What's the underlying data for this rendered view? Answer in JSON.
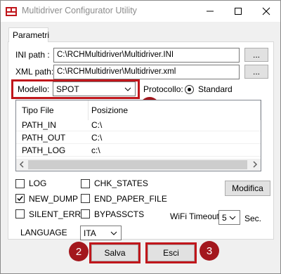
{
  "window": {
    "title": "Multidriver Configurator Utility"
  },
  "tabs": [
    {
      "label": "Parametri"
    }
  ],
  "ini": {
    "label": "INI path :",
    "value": "C:\\RCHMultidriver\\Multidriver.INI",
    "browse_label": "..."
  },
  "xml": {
    "label": "XML path:",
    "value": "C:\\RCHMultidriver\\Multidriver.xml",
    "browse_label": "..."
  },
  "modello": {
    "label": "Modello:",
    "value": "SPOT"
  },
  "protocollo": {
    "label": "Protocollo:",
    "option": "Standard",
    "selected": true
  },
  "table": {
    "columns": [
      "Tipo File",
      "Posizione"
    ],
    "rows": [
      {
        "tipo": "PATH_IN",
        "pos": "C:\\"
      },
      {
        "tipo": "PATH_OUT",
        "pos": "C:\\"
      },
      {
        "tipo": "PATH_LOG",
        "pos": "c:\\"
      }
    ]
  },
  "options": {
    "log": {
      "label": "LOG",
      "checked": false
    },
    "new_dump": {
      "label": "NEW_DUMP",
      "checked": true
    },
    "silent_err": {
      "label": "SILENT_ERR",
      "checked": false
    },
    "chk_states": {
      "label": "CHK_STATES",
      "checked": false
    },
    "end_paper_file": {
      "label": "END_PAPER_FILE",
      "checked": false
    },
    "bypassctS": {
      "label": "BYPASSCTS",
      "checked": false
    }
  },
  "modifica_label": "Modifica",
  "wifi": {
    "label": "WiFi Timeout",
    "value": "5",
    "unit": "Sec."
  },
  "language": {
    "label": "LANGUAGE",
    "value": "ITA"
  },
  "actions": {
    "save_label": "Salva",
    "exit_label": "Esci"
  },
  "badges": {
    "one": "1",
    "two": "2",
    "three": "3"
  },
  "colors": {
    "highlight": "#c0161b",
    "badge": "#a3171d",
    "panel": "#ffffff",
    "chrome": "#f0f0f0"
  }
}
